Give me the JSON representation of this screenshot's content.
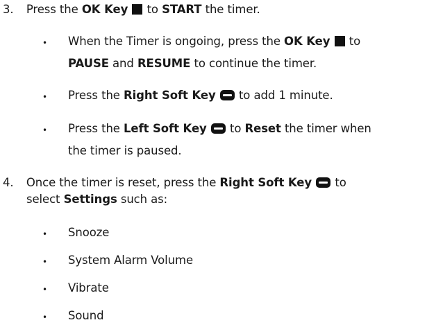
{
  "steps": [
    {
      "number": "3.",
      "line1": {
        "pre": "Press the ",
        "key": "OK Key",
        "mid": " to ",
        "bold2": "START",
        "post": " the timer."
      },
      "bullets": [
        {
          "line1": {
            "pre": "When the Timer is ongoing, press the ",
            "key": "OK Key",
            "post": " to"
          },
          "line2": {
            "b1": "PAUSE",
            "mid": " and ",
            "b2": "RESUME",
            "post": " to continue the timer."
          }
        },
        {
          "line1": {
            "pre": "Press the ",
            "key": "Right Soft Key",
            "post": " to add 1 minute."
          }
        },
        {
          "line1": {
            "pre": "Press the ",
            "key": "Left Soft Key",
            "mid": " to ",
            "b2": "Reset",
            "post": " the timer when"
          },
          "line2": {
            "text": "the timer is paused."
          }
        }
      ]
    },
    {
      "number": "4.",
      "line1": {
        "pre": "Once the timer is reset, press the ",
        "key": "Right Soft Key",
        "post": " to"
      },
      "line2": {
        "pre": "select ",
        "bold": "Settings",
        "post": " such as:"
      },
      "bullets": [
        "Snooze",
        "System Alarm Volume",
        "Vibrate",
        "Sound"
      ]
    }
  ],
  "bullet_glyph": "•",
  "icons": {
    "ok_key": "ok-key-square-icon",
    "soft_key": "soft-key-rounded-icon"
  }
}
